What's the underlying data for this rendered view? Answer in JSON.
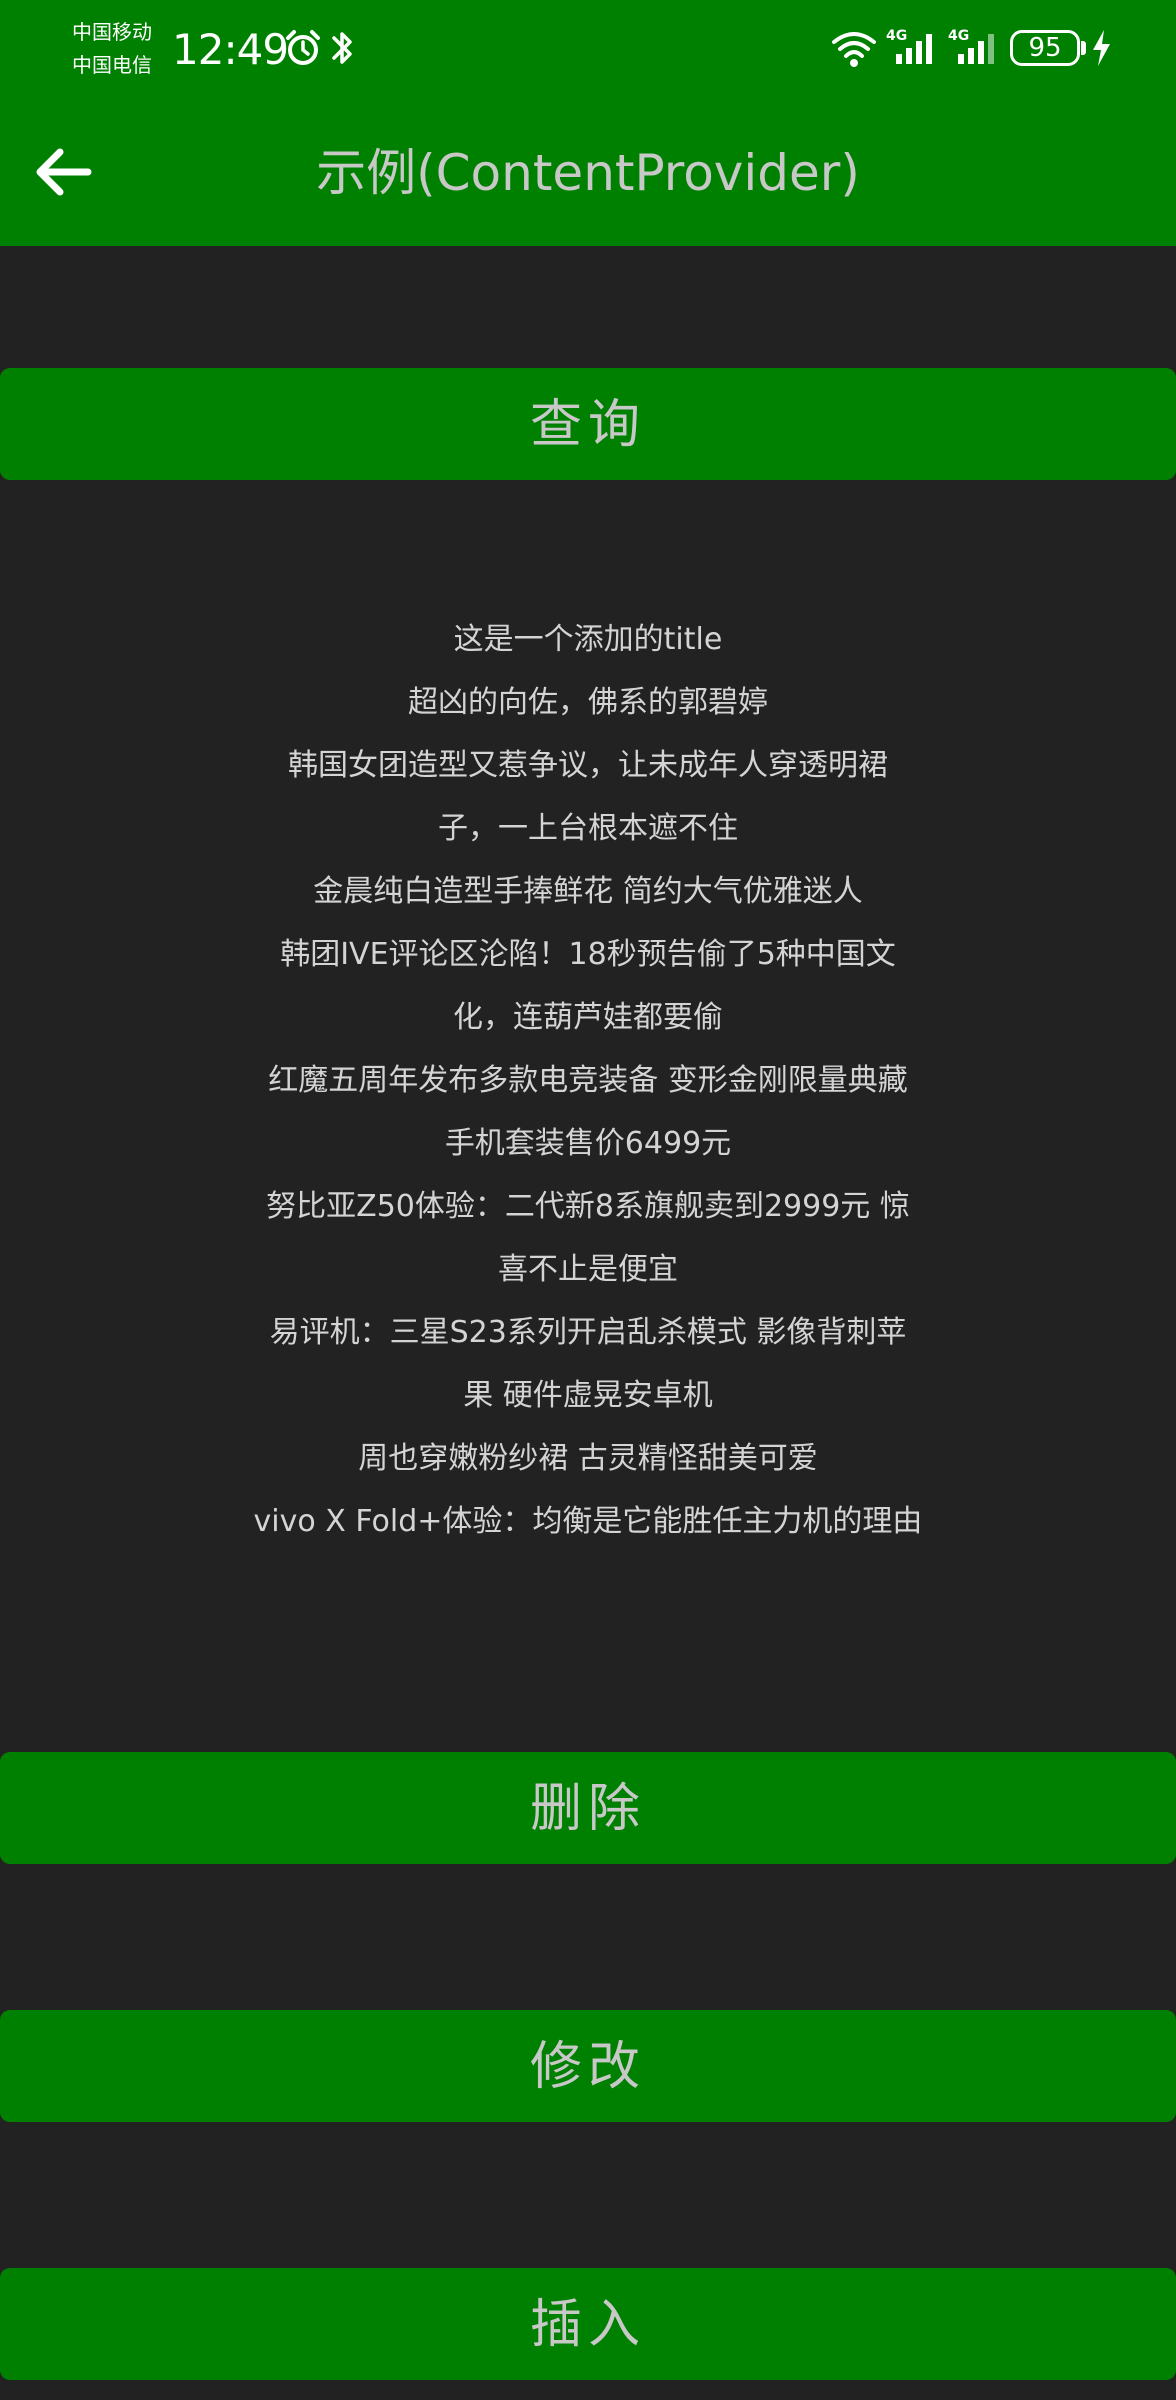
{
  "status_bar": {
    "carrier_1": "中国移动",
    "carrier_2": "中国电信",
    "time": "12:49",
    "network_1": "4G",
    "network_2": "4G",
    "battery": "95",
    "icons": [
      "alarm-icon",
      "bluetooth-icon",
      "wifi-icon",
      "signal-icon",
      "signal-icon",
      "battery-icon",
      "charging-icon"
    ]
  },
  "toolbar": {
    "title": "示例(ContentProvider)",
    "back_icon": "arrow-left-icon"
  },
  "buttons": {
    "query": "查询",
    "delete": "删除",
    "update": "修改",
    "insert": "插入"
  },
  "results": {
    "lines": [
      "这是一个添加的title",
      "超凶的向佐，佛系的郭碧婷",
      "韩国女团造型又惹争议，让未成年人穿透明裙",
      "子，一上台根本遮不住",
      "金晨纯白造型手捧鲜花 简约大气优雅迷人",
      "韩团IVE评论区沦陷！18秒预告偷了5种中国文",
      "化，连葫芦娃都要偷",
      "红魔五周年发布多款电竞装备 变形金刚限量典藏",
      "手机套装售价6499元",
      "努比亚Z50体验：二代新8系旗舰卖到2999元 惊",
      "喜不止是便宜",
      "易评机：三星S23系列开启乱杀模式 影像背刺苹",
      "果 硬件虚晃安卓机",
      "周也穿嫩粉纱裙 古灵精怪甜美可爱",
      "vivo X Fold+体验：均衡是它能胜任主力机的理由"
    ]
  },
  "colors": {
    "primary": "#008000",
    "background": "#222222",
    "text": "#d4d4d4"
  }
}
